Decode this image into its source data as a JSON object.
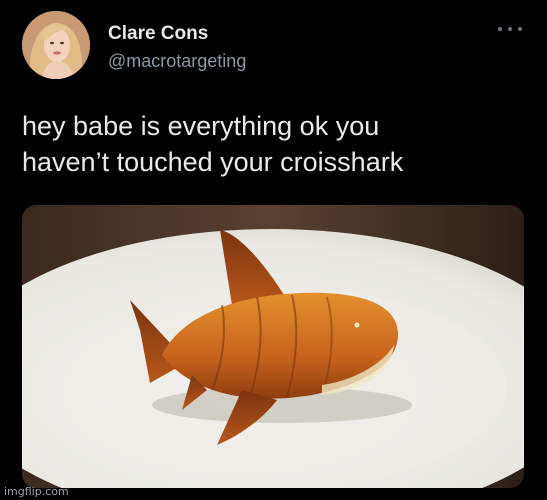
{
  "tweet": {
    "display_name": "Clare Cons",
    "handle": "@macrotargeting",
    "text_line_1": "hey babe is everything ok you",
    "text_line_2": "haven’t touched your croisshark",
    "more_icon": "ellipsis-icon"
  },
  "media": {
    "subject": "croissant-shaped-shark-on-plate"
  },
  "watermark": "imgflip.com",
  "colors": {
    "background": "#000000",
    "text_primary": "#e7e9ea",
    "text_secondary": "#8b98a5"
  }
}
